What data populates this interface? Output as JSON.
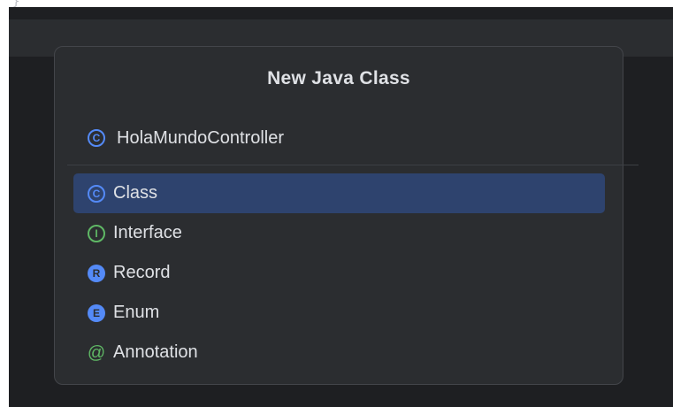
{
  "dialog": {
    "title": "New Java Class",
    "name_value": "HolaMundoController",
    "name_icon": "class-icon",
    "kinds": [
      {
        "label": "Class",
        "icon": "class-icon",
        "glyph": "C",
        "selected": true
      },
      {
        "label": "Interface",
        "icon": "interface-icon",
        "glyph": "I",
        "selected": false
      },
      {
        "label": "Record",
        "icon": "record-icon",
        "glyph": "R",
        "selected": false
      },
      {
        "label": "Enum",
        "icon": "enum-icon",
        "glyph": "E",
        "selected": false
      },
      {
        "label": "Annotation",
        "icon": "annotation-icon",
        "glyph": "@",
        "selected": false
      }
    ]
  },
  "editor": {
    "brace": "}"
  },
  "colors": {
    "accent_blue": "#548af7",
    "accent_green": "#5fb865",
    "selection": "#2e436e",
    "dialog_bg": "#2b2d30",
    "editor_bg": "#1e1f22"
  }
}
